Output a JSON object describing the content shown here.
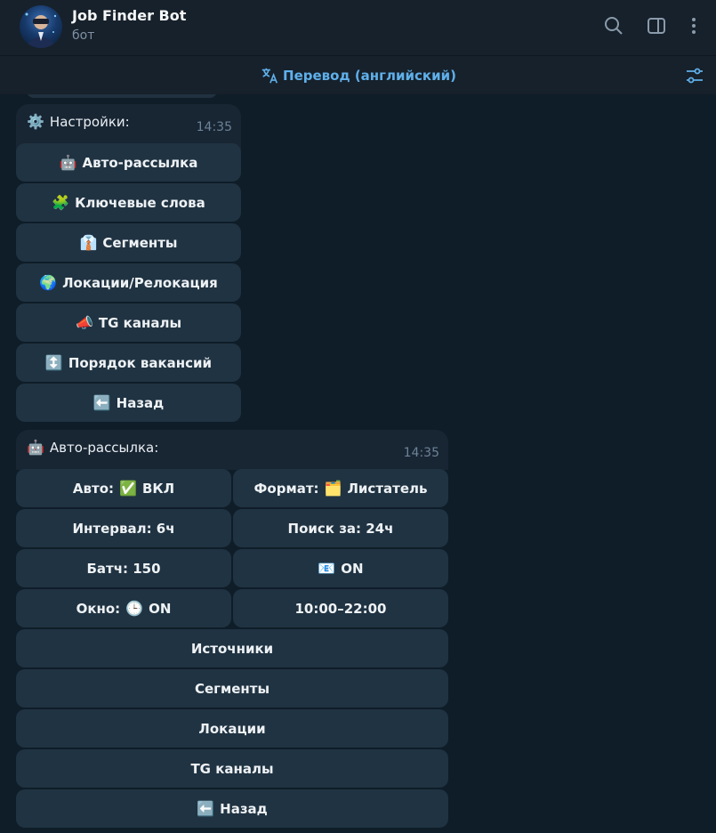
{
  "header": {
    "title": "Job Finder Bot",
    "subtitle": "бот",
    "icons": [
      "search-icon",
      "sidebar-toggle-icon",
      "more-vertical-icon"
    ]
  },
  "translate_bar": {
    "label": "Перевод (английский)",
    "icon": "translate-icon",
    "filter_icon": "filter-settings-icon"
  },
  "colors": {
    "accent": "#5fb0ea",
    "header_bg": "#17212b",
    "bubble_bg": "#182533",
    "button_bg": "#203342"
  },
  "settings_message": {
    "emoji": "⚙️",
    "text": "Настройки:",
    "time": "14:35",
    "buttons": [
      {
        "emoji": "🤖",
        "label": "Авто-рассылка"
      },
      {
        "emoji": "🧩",
        "label": "Ключевые слова"
      },
      {
        "emoji": "👔",
        "label": "Сегменты"
      },
      {
        "emoji": "🌍",
        "label": "Локации/Релокация"
      },
      {
        "emoji": "📣",
        "label": "TG каналы"
      },
      {
        "emoji": "↕️",
        "label": "Порядок вакансий"
      },
      {
        "emoji": "⬅️",
        "label": "Назад"
      }
    ]
  },
  "auto_message": {
    "emoji": "🤖",
    "text": "Авто-рассылка:",
    "time": "14:35",
    "grid": [
      [
        {
          "label": "Авто:",
          "emoji": "✅",
          "suffix": "ВКЛ"
        },
        {
          "label": "Формат:",
          "emoji": "🗂️",
          "suffix": "Листатель"
        }
      ],
      [
        {
          "label": "Интервал: 6ч",
          "emoji": "",
          "suffix": ""
        },
        {
          "label": "Поиск за: 24ч",
          "emoji": "",
          "suffix": ""
        }
      ],
      [
        {
          "label": "Батч: 150",
          "emoji": "",
          "suffix": ""
        },
        {
          "label": "",
          "emoji": "📧",
          "suffix": "ON"
        }
      ],
      [
        {
          "label": "Окно:",
          "emoji": "🕒",
          "suffix": "ON"
        },
        {
          "label": "10:00–22:00",
          "emoji": "",
          "suffix": ""
        }
      ]
    ],
    "full_buttons": [
      {
        "emoji": "",
        "label": "Источники"
      },
      {
        "emoji": "",
        "label": "Сегменты"
      },
      {
        "emoji": "",
        "label": "Локации"
      },
      {
        "emoji": "",
        "label": "TG каналы"
      },
      {
        "emoji": "⬅️",
        "label": "Назад"
      }
    ]
  }
}
